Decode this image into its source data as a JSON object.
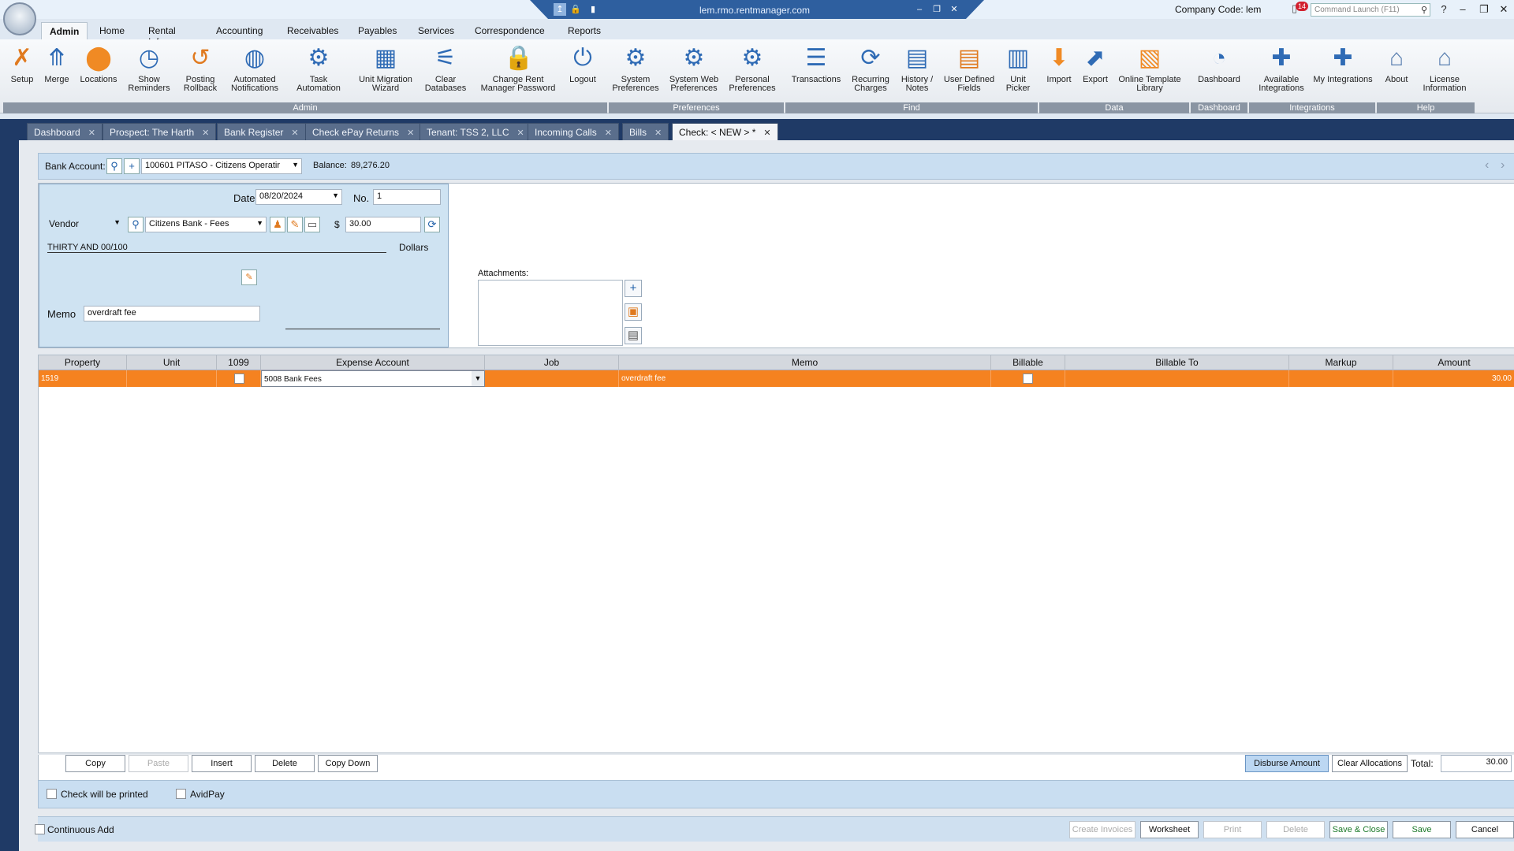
{
  "window": {
    "url": "lem.rmo.rentmanager.com",
    "company_code": "Company Code: lem",
    "notifications": "14",
    "command_placeholder": "Command Launch (F11)"
  },
  "menu": [
    "Admin",
    "Home",
    "Rental Info",
    "Accounting",
    "Receivables",
    "Payables",
    "Services",
    "Correspondence",
    "Reports"
  ],
  "ribbon": {
    "buttons": [
      "Setup",
      "Merge",
      "Locations",
      "Show Reminders",
      "Posting Rollback",
      "Automated Notifications",
      "Task Automation",
      "Unit Migration Wizard",
      "Clear Databases",
      "Change Rent Manager Password",
      "Logout",
      "System Preferences",
      "System Web Preferences",
      "Personal Preferences",
      "Transactions",
      "Recurring Charges",
      "History / Notes",
      "User Defined Fields",
      "Unit Picker",
      "Import",
      "Export",
      "Online Template Library",
      "Dashboard",
      "Available Integrations",
      "My Integrations",
      "About",
      "License Information"
    ],
    "groups": [
      "Admin",
      "Preferences",
      "Find",
      "Data",
      "Dashboard",
      "Integrations",
      "Help"
    ]
  },
  "tabs": [
    "Dashboard",
    "Prospect: The Harth",
    "Bank Register",
    "Check ePay Returns",
    "Tenant: TSS 2, LLC",
    "Incoming Calls",
    "Bills",
    "Check: < NEW > *"
  ],
  "bank": {
    "label": "Bank Account:",
    "account": "100601 PITASO - Citizens Operatir",
    "balance_label": "Balance:",
    "balance": "89,276.20"
  },
  "check": {
    "date_label": "Date",
    "date": "08/20/2024",
    "no_label": "No.",
    "no": "1",
    "payee_type": "Vendor",
    "payee": "Citizens Bank - Fees",
    "currency": "$",
    "amount": "30.00",
    "amount_words": "THIRTY AND 00/100",
    "dollars": "Dollars",
    "memo_label": "Memo",
    "memo": "overdraft fee",
    "attachments_label": "Attachments:"
  },
  "grid": {
    "headers": [
      "Property",
      "Unit",
      "1099",
      "Expense Account",
      "Job",
      "Memo",
      "Billable",
      "Billable To",
      "Markup",
      "Amount"
    ],
    "row": {
      "property": "1519",
      "unit": "",
      "expense_account": "5008 Bank Fees",
      "job": "",
      "memo": "overdraft fee",
      "billable_to": "",
      "markup": "",
      "amount": "30.00"
    }
  },
  "grid_toolbar": {
    "copy": "Copy",
    "paste": "Paste",
    "insert": "Insert",
    "delete": "Delete",
    "copy_down": "Copy Down",
    "disburse": "Disburse Amount",
    "clear_alloc": "Clear Allocations",
    "total_label": "Total:",
    "total": "30.00"
  },
  "options": {
    "check_printed": "Check will be printed",
    "avidpay": "AvidPay"
  },
  "footer": {
    "continuous_add": "Continuous Add",
    "create_invoices": "Create Invoices",
    "worksheet": "Worksheet",
    "print": "Print",
    "delete": "Delete",
    "save_close": "Save & Close",
    "save": "Save",
    "cancel": "Cancel"
  }
}
